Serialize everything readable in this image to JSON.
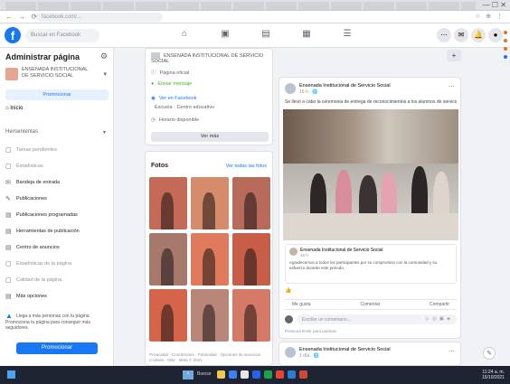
{
  "browser": {
    "url": "facebook.com/...",
    "window_controls": "— ☐ ✕",
    "nav": "← → ⟳",
    "extensions": "☆ ⊕ ⋮"
  },
  "fb": {
    "logo": "f",
    "search_placeholder": "Buscar en Facebook",
    "nav_icons": [
      "⌂",
      "▣",
      "▤",
      "▦",
      "☰"
    ],
    "right_icons": [
      "⋯",
      "✉",
      "🔔",
      "●"
    ]
  },
  "sidebar": {
    "title": "Administrar página",
    "page_name": "ENSENADA INSTITUCIONAL DE SERVICIO SOCIAL",
    "promote": "Promocionar",
    "home": "Inicio",
    "section": "Herramientas",
    "items": [
      {
        "icon": "▢",
        "label": "Tareas pendientes"
      },
      {
        "icon": "▢",
        "label": "Estadísticas"
      },
      {
        "icon": "✉",
        "label": "Bandeja de entrada"
      },
      {
        "icon": "✎",
        "label": "Publicaciones"
      },
      {
        "icon": "▤",
        "label": "Publicaciones programadas"
      },
      {
        "icon": "▤",
        "label": "Herramientas de publicación"
      },
      {
        "icon": "▤",
        "label": "Centro de anuncios"
      },
      {
        "icon": "▢",
        "label": "Estadísticas de la página"
      },
      {
        "icon": "▢",
        "label": "Calidad de la página"
      },
      {
        "icon": "▤",
        "label": "Más opciones"
      }
    ],
    "promo_text": "Llega a más personas con tu página. Promociona tu página para conseguir más seguidores.",
    "boost": "Promocionar"
  },
  "about": {
    "header": "ENSENADA INSTITUCIONAL DE SERVICIO SOCIAL",
    "rows": [
      "Página oficial",
      "Enviar mensaje",
      "Ver en Facebook",
      "Escuela · Centro educativo",
      "Horario disponible"
    ],
    "button": "Ver más"
  },
  "photos": {
    "title": "Fotos",
    "see_all": "Ver todas las fotos",
    "footer": "Privacidad · Condiciones · Publicidad · Opciones de anuncios · Cookies · Más · Meta © 2021"
  },
  "post": {
    "author": "Ensenada Institucional de Servicio Social",
    "time": "16 h · 🌐",
    "text": "Se llevó a cabo la ceremonia de entrega de reconocimientos a los alumnos de servicio social.",
    "shared_author": "Ensenada Institucional de Servicio Social",
    "shared_time": "16 h",
    "shared_text": "Agradecemos a todos los participantes por su compromiso con la comunidad y su esfuerzo durante este periodo.",
    "reactions": "👍",
    "actions": [
      "Me gusta",
      "Comentar",
      "Compartir"
    ],
    "comment_placeholder": "Escribe un comentario...",
    "emoji_row": "☺ ◎ ▣ ◈",
    "footer": "Presiona Enter para publicar."
  },
  "post2": {
    "author": "Ensenada Institucional de Servicio Social",
    "time": "1 día · 🌐"
  },
  "taskbar": {
    "search": "Buscar",
    "time": "11:24 a. m.",
    "date": "15/10/2021"
  },
  "icons": {
    "create": "+",
    "float": "✎",
    "more": "⋯",
    "gear": "⚙",
    "caret": "▾",
    "home": "⌂"
  },
  "colors": {
    "brand": "#1877f2",
    "sidebar_bg": "#ffffff",
    "taskbar": "#1f2433"
  }
}
